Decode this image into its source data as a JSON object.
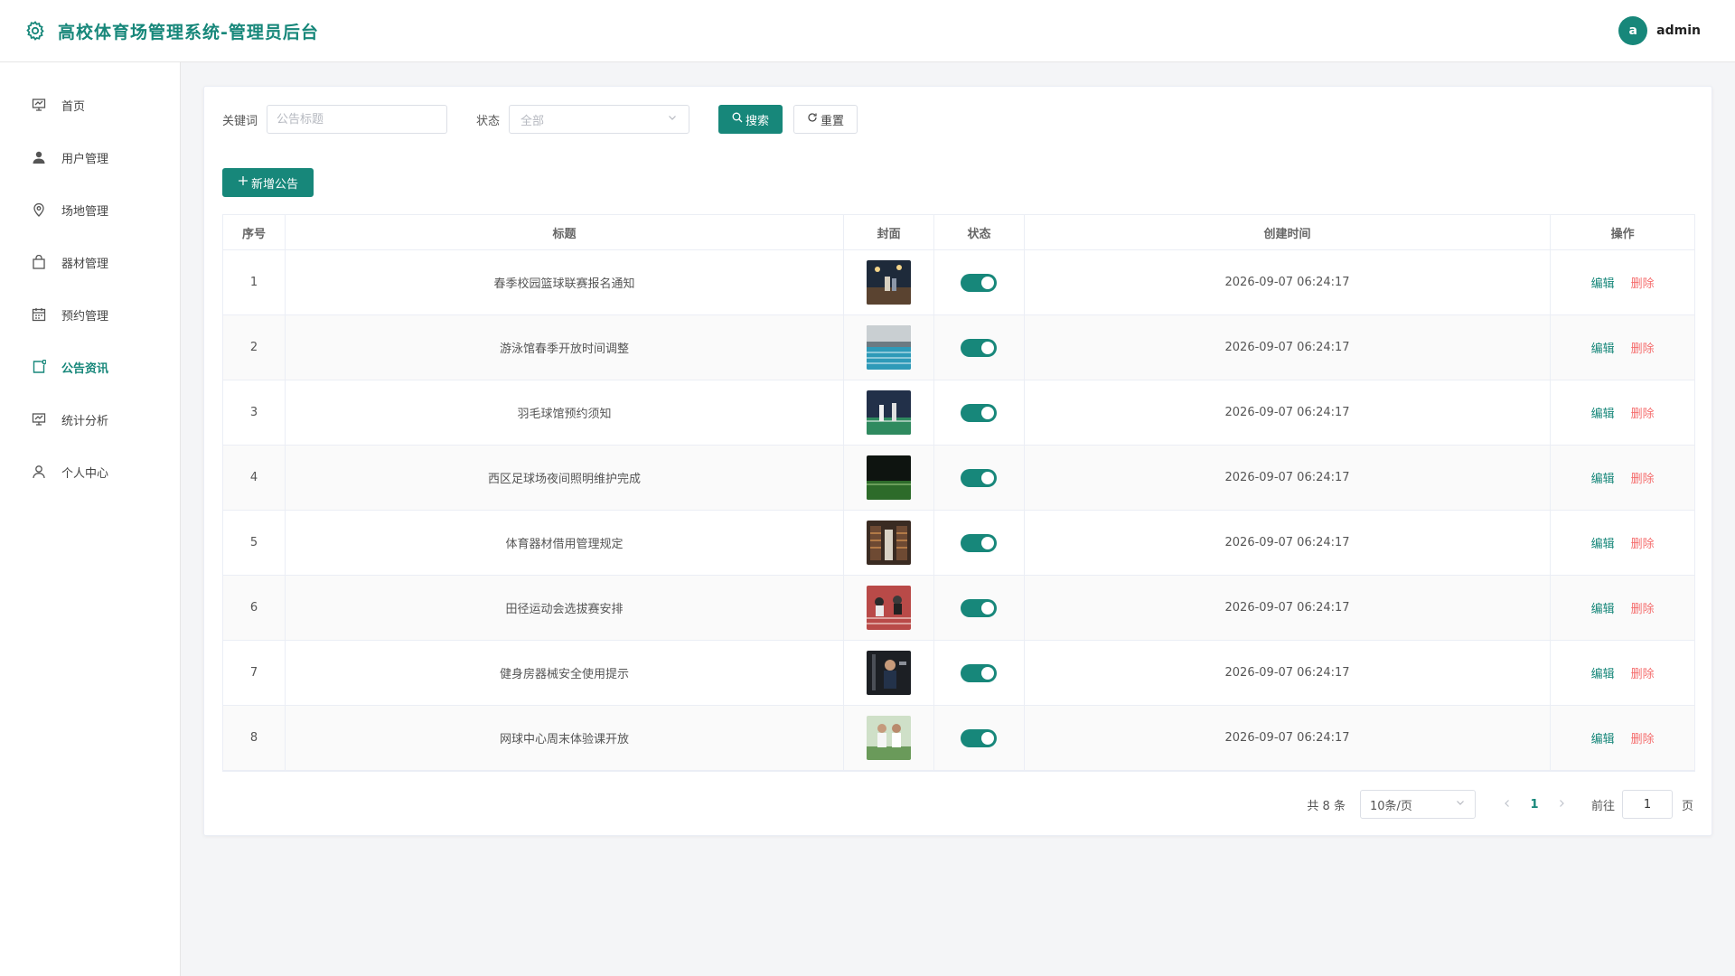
{
  "header": {
    "title": "高校体育场管理系统-管理员后台",
    "avatar_letter": "a",
    "username": "admin"
  },
  "sidebar": {
    "items": [
      {
        "label": "首页",
        "icon": "monitor-icon"
      },
      {
        "label": "用户管理",
        "icon": "user-icon"
      },
      {
        "label": "场地管理",
        "icon": "location-icon"
      },
      {
        "label": "器材管理",
        "icon": "bag-icon"
      },
      {
        "label": "预约管理",
        "icon": "calendar-icon"
      },
      {
        "label": "公告资讯",
        "icon": "notice-icon",
        "active": true
      },
      {
        "label": "统计分析",
        "icon": "chart-icon"
      },
      {
        "label": "个人中心",
        "icon": "profile-icon"
      }
    ]
  },
  "filters": {
    "keyword_label": "关键词",
    "keyword_placeholder": "公告标题",
    "status_label": "状态",
    "status_value": "全部",
    "search_label": "搜索",
    "reset_label": "重置"
  },
  "add_button_label": "新增公告",
  "table": {
    "headers": [
      "序号",
      "标题",
      "封面",
      "状态",
      "创建时间",
      "操作"
    ],
    "rows": [
      {
        "index": "1",
        "title": "春季校园篮球联赛报名通知",
        "created": "2026-09-07 06:24:17"
      },
      {
        "index": "2",
        "title": "游泳馆春季开放时间调整",
        "created": "2026-09-07 06:24:17"
      },
      {
        "index": "3",
        "title": "羽毛球馆预约须知",
        "created": "2026-09-07 06:24:17"
      },
      {
        "index": "4",
        "title": "西区足球场夜间照明维护完成",
        "created": "2026-09-07 06:24:17"
      },
      {
        "index": "5",
        "title": "体育器材借用管理规定",
        "created": "2026-09-07 06:24:17"
      },
      {
        "index": "6",
        "title": "田径运动会选拔赛安排",
        "created": "2026-09-07 06:24:17"
      },
      {
        "index": "7",
        "title": "健身房器械安全使用提示",
        "created": "2026-09-07 06:24:17"
      },
      {
        "index": "8",
        "title": "网球中心周末体验课开放",
        "created": "2026-09-07 06:24:17"
      }
    ],
    "edit_label": "编辑",
    "delete_label": "删除"
  },
  "pagination": {
    "total_text": "共 8 条",
    "page_size": "10条/页",
    "current_page": "1",
    "goto_label": "前往",
    "goto_value": "1",
    "page_suffix": "页"
  },
  "colors": {
    "accent": "#17877a",
    "danger": "#f56c6c"
  }
}
